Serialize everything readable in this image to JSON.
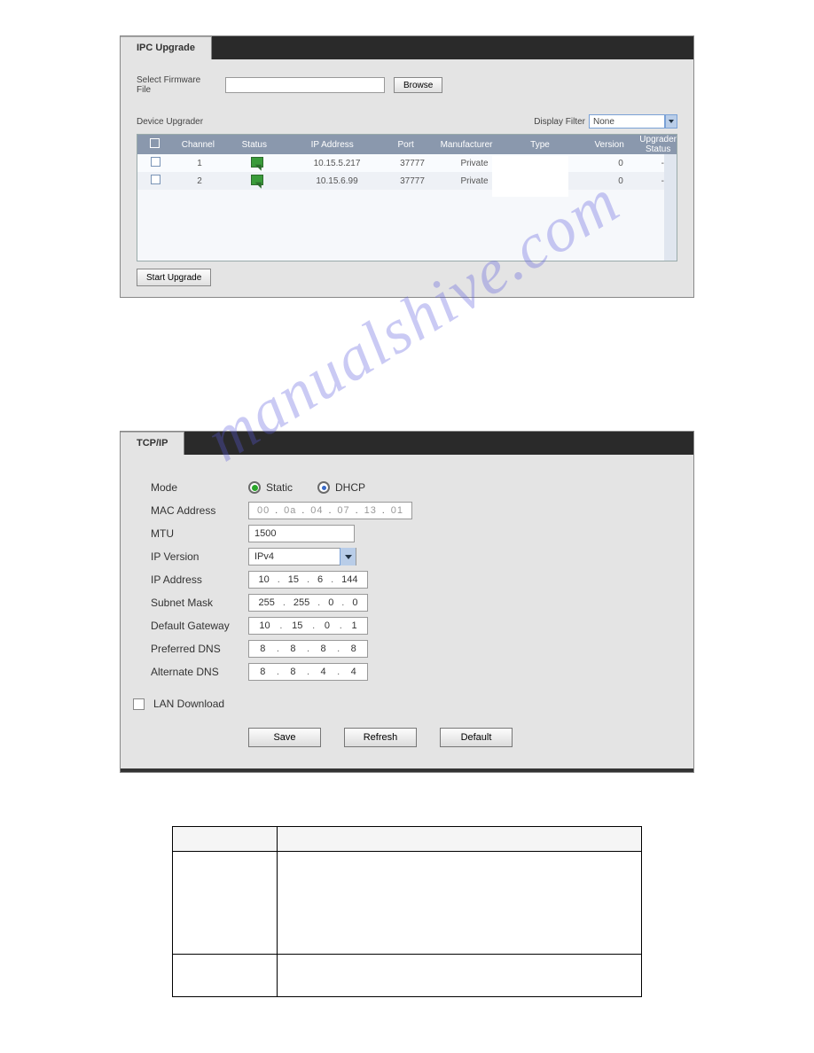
{
  "ipc": {
    "tab_label": "IPC Upgrade",
    "select_firmware_label": "Select Firmware File",
    "browse_label": "Browse",
    "device_upgrader_label": "Device Upgrader",
    "display_filter_label": "Display Filter",
    "display_filter_value": "None",
    "columns": {
      "channel": "Channel",
      "status": "Status",
      "ip": "IP Address",
      "port": "Port",
      "manufacturer": "Manufacturer",
      "type": "Type",
      "version": "Version",
      "upgrader_status": "Upgrader Status"
    },
    "rows": [
      {
        "channel": "1",
        "ip": "10.15.5.217",
        "port": "37777",
        "manufacturer": "Private",
        "type": "",
        "version": "0",
        "upgrader": "--"
      },
      {
        "channel": "2",
        "ip": "10.15.6.99",
        "port": "37777",
        "manufacturer": "Private",
        "type": "",
        "version": "0",
        "upgrader": "--"
      }
    ],
    "start_upgrade_label": "Start Upgrade"
  },
  "tcpip": {
    "tab_label": "TCP/IP",
    "mode_label": "Mode",
    "mode_static": "Static",
    "mode_dhcp": "DHCP",
    "mode_selected": "static",
    "mac_label": "MAC Address",
    "mac": [
      "00",
      "0a",
      "04",
      "07",
      "13",
      "01"
    ],
    "mtu_label": "MTU",
    "mtu": "1500",
    "ipver_label": "IP Version",
    "ipver": "IPv4",
    "ipaddr_label": "IP Address",
    "ipaddr": [
      "10",
      "15",
      "6",
      "144"
    ],
    "subnet_label": "Subnet Mask",
    "subnet": [
      "255",
      "255",
      "0",
      "0"
    ],
    "gateway_label": "Default Gateway",
    "gateway": [
      "10",
      "15",
      "0",
      "1"
    ],
    "pdns_label": "Preferred DNS",
    "pdns": [
      "8",
      "8",
      "8",
      "8"
    ],
    "adns_label": "Alternate DNS",
    "adns": [
      "8",
      "8",
      "4",
      "4"
    ],
    "lan_download_label": "LAN Download",
    "save_label": "Save",
    "refresh_label": "Refresh",
    "default_label": "Default"
  },
  "watermark": "manualshive.com"
}
